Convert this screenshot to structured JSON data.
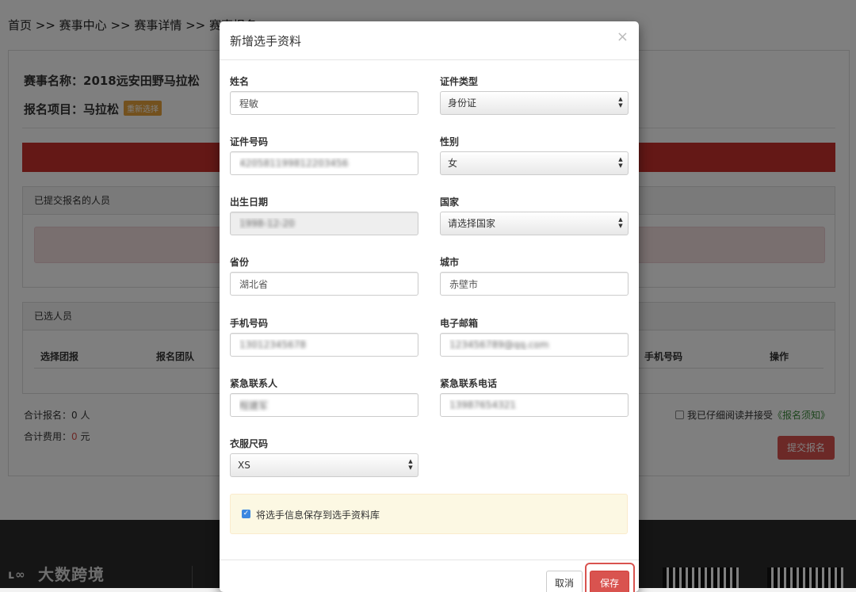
{
  "breadcrumb": "首页 >> 赛事中心 >> 赛事详情 >> 赛事报名",
  "event": {
    "name_line": "赛事名称：2018远安田野马拉松",
    "project_line": "报名项目：马拉松",
    "reselect_label": "重新选择"
  },
  "submitted_panel": {
    "title": "已提交报名的人员"
  },
  "selected_panel": {
    "title": "已选人员",
    "columns": [
      "选择团报",
      "报名团队",
      "手机号码",
      "操作"
    ]
  },
  "totals": {
    "count_label": "合计报名：",
    "count_value": "0",
    "count_unit": " 人",
    "fee_label": "合计费用：",
    "fee_value": "0",
    "fee_unit": " 元"
  },
  "agreement": {
    "prefix": "我已仔细阅读并接受",
    "link": "《报名须知》"
  },
  "submit_button": "提交报名",
  "footer": {
    "logo_text": "大数跨境"
  },
  "modal": {
    "title": "新增选手资料",
    "close": "×",
    "fields": {
      "name": {
        "label": "姓名",
        "value": "程敏"
      },
      "id_type": {
        "label": "证件类型",
        "value": "身份证"
      },
      "id_number": {
        "label": "证件号码",
        "value": "420581199812203456"
      },
      "gender": {
        "label": "性别",
        "value": "女"
      },
      "birth_date": {
        "label": "出生日期",
        "value": "1998-12-20"
      },
      "country": {
        "label": "国家",
        "value": "请选择国家"
      },
      "province": {
        "label": "省份",
        "value": "湖北省"
      },
      "city": {
        "label": "城市",
        "value": "赤壁市"
      },
      "phone": {
        "label": "手机号码",
        "value": "13012345678"
      },
      "email": {
        "label": "电子邮箱",
        "value": "123456789@qq.com"
      },
      "emergency_contact": {
        "label": "紧急联系人",
        "value": "程建军"
      },
      "emergency_phone": {
        "label": "紧急联系电话",
        "value": "13987654321"
      },
      "size": {
        "label": "衣服尺码",
        "value": "XS"
      }
    },
    "save_to_db": {
      "checked": true,
      "label": "将选手信息保存到选手资料库"
    },
    "cancel_button": "取消",
    "save_button": "保存"
  }
}
